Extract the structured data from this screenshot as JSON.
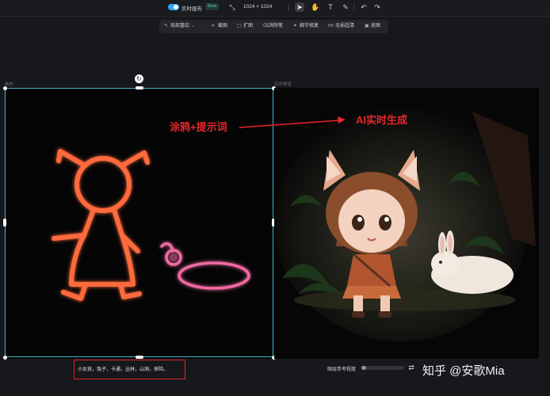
{
  "toolbar": {
    "realtime_label": "实时画布",
    "badge": "Beta",
    "size_label": "1024 × 1024"
  },
  "subtoolbar": {
    "items": [
      "局部重绘",
      "截图",
      "扩图",
      "消除笔",
      "细节修复",
      "无损超清",
      "抠图"
    ]
  },
  "canvas": {
    "left_label": "画布",
    "right_label": "实时预览"
  },
  "annotations": {
    "left": "涂鸦+提示词",
    "right": "AI实时生成"
  },
  "prompt": {
    "text": "小女孩，兔子，卡通，丛林，山洞，探险。"
  },
  "reference": {
    "label": "图层参考程度",
    "level": 0.12
  },
  "watermark": "知乎 @安歌Mia",
  "colors": {
    "doodle": "#ff6a3d",
    "doodle_ring": "#f06aa0",
    "selection": "#3fb6c8",
    "annotation_red": "#e8262b"
  }
}
